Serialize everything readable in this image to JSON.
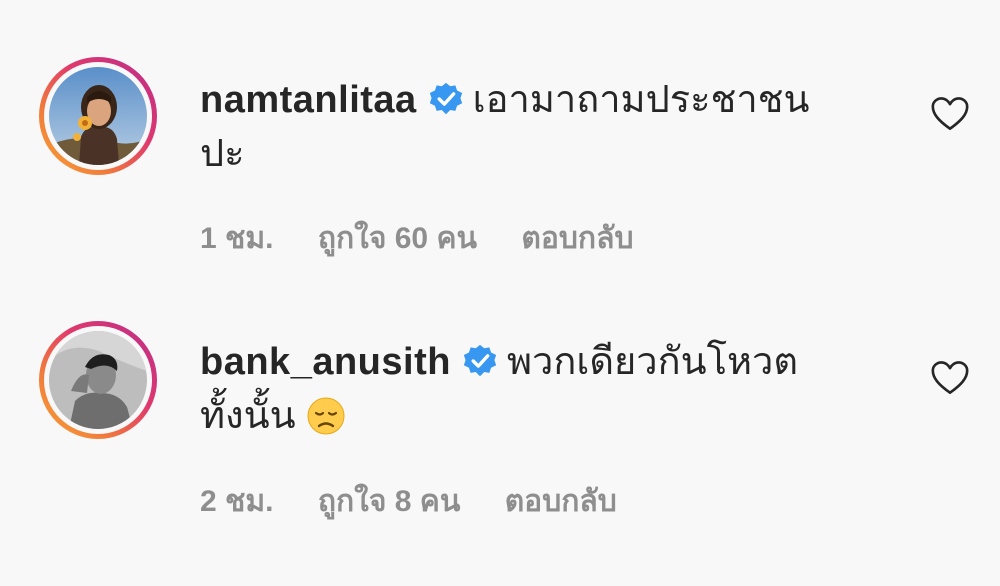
{
  "comments": [
    {
      "username": "namtanlitaa",
      "text_line1": "เอามาถามประชาชน",
      "text_line2": "ปะ",
      "time": "1 ชม.",
      "likes": "ถูกใจ 60 คน",
      "reply": "ตอบกลับ",
      "verified": true,
      "avatar_icon": "avatar-photo-woman"
    },
    {
      "username": "bank_anusith",
      "text_line1": "พวกเดียวกันโหวต",
      "text_line2": "ทั้งนั้น",
      "emoji": "disappointed-face",
      "time": "2 ชม.",
      "likes": "ถูกใจ 8 คน",
      "reply": "ตอบกลับ",
      "verified": true,
      "avatar_icon": "avatar-photo-man"
    }
  ],
  "colors": {
    "verified_badge": "#3897f0",
    "meta_text": "#8e8e8e",
    "text": "#262626",
    "ring_start": "#f9a533",
    "ring_end": "#b62f8f"
  }
}
